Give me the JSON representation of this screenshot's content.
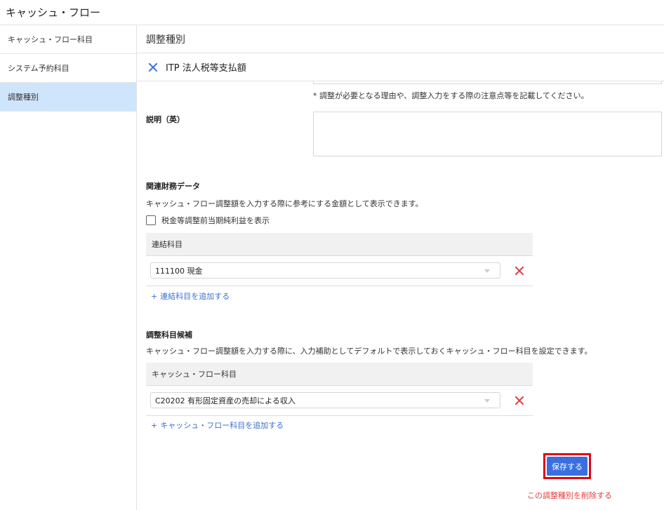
{
  "app": {
    "title": "キャッシュ・フロー"
  },
  "sidebar": {
    "items": [
      {
        "label": "キャッシュ・フロー科目",
        "active": false
      },
      {
        "label": "システム予約科目",
        "active": false
      },
      {
        "label": "調整種別",
        "active": true
      }
    ]
  },
  "main": {
    "section_title": "調整種別",
    "item_title": "ITP 法人税等支払額",
    "description_hint": "* 調整が必要となる理由や、調整入力をする際の注意点等を記載してください。",
    "description_en": {
      "label": "説明（英）",
      "value": ""
    },
    "related_financial": {
      "title": "関連財務データ",
      "description": "キャッシュ・フロー調整額を入力する際に参考にする金額として表示できます。",
      "checkbox_label": "税金等調整前当期純利益を表示",
      "checkbox_checked": false,
      "table_header": "連結科目",
      "rows": [
        {
          "value": "111100 現金"
        }
      ],
      "add_link": "連結科目を追加する"
    },
    "adjustment_candidates": {
      "title": "調整科目候補",
      "description": "キャッシュ・フロー調整額を入力する際に、入力補助としてデフォルトで表示しておくキャッシュ・フロー科目を設定できます。",
      "table_header": "キャッシュ・フロー科目",
      "rows": [
        {
          "value": "C20202 有形固定資産の売却による収入"
        }
      ],
      "add_link": "キャッシュ・フロー科目を追加する"
    },
    "save_button": "保存する",
    "delete_link": "この調整種別を削除する"
  },
  "colors": {
    "accent": "#3b6fe0",
    "danger": "#e03c3c",
    "highlight": "#e3001b",
    "sidebar_active": "#cfe5fb"
  },
  "icons": {
    "close": "close-icon",
    "delete": "delete-icon",
    "dropdown": "chevron-down-icon",
    "add": "plus-icon"
  }
}
